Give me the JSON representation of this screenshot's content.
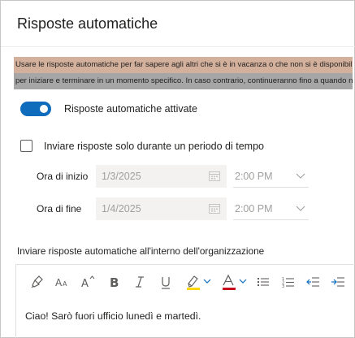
{
  "panel": {
    "title": "Risposte automatiche"
  },
  "description": {
    "line1": "Usare le risposte automatiche per far sapere agli altri che si è in vacanza o che non si è disponibili",
    "line2": "per iniziare e terminare in un momento specifico. In caso contrario, continueranno fino a quando non"
  },
  "toggle": {
    "label": "Risposte automatiche attivate",
    "on": true
  },
  "time_period": {
    "checkbox_label": "Inviare risposte solo durante un periodo di tempo",
    "checked": false,
    "start": {
      "label": "Ora di inizio",
      "date": "1/3/2025",
      "time": "2:00 PM"
    },
    "end": {
      "label": "Ora di fine",
      "date": "1/4/2025",
      "time": "2:00 PM"
    }
  },
  "org": {
    "label": "Inviare risposte automatiche all'interno dell'organizzazione"
  },
  "toolbar": {
    "items": [
      "format-painter-icon",
      "font-size-icon",
      "grow-font-icon",
      "bold-icon",
      "italic-icon",
      "underline-icon",
      "highlight-icon",
      "font-color-icon",
      "bullets-icon",
      "numbering-icon",
      "decrease-indent-icon",
      "increase-indent-icon"
    ],
    "highlight_color": "#ffd800",
    "font_color": "#c50f1f"
  },
  "editor": {
    "body": "Ciao! Sarò fuori ufficio lunedì e martedì."
  },
  "colors": {
    "accent": "#0f6cbd",
    "highlight_line1": "#d3b09c",
    "highlight_line2": "#a6a6a6"
  }
}
